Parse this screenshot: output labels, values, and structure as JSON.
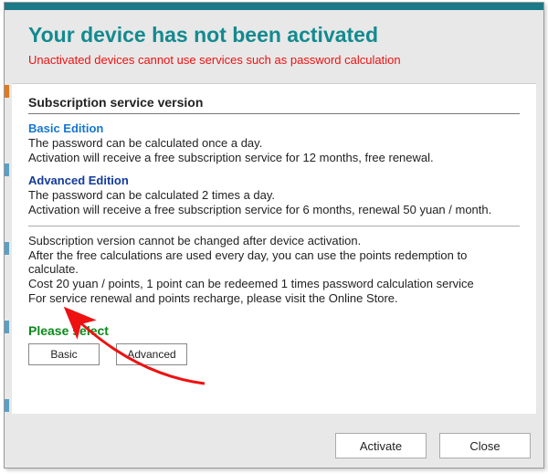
{
  "header": {
    "title": "Your device has not been activated",
    "warning": "Unactivated devices cannot use services such as password calculation"
  },
  "subscription": {
    "section_title": "Subscription service version",
    "basic": {
      "name": "Basic Edition",
      "line1": "The password can be calculated once a day.",
      "line2": "Activation will receive a free subscription service for 12 months, free renewal."
    },
    "advanced": {
      "name": "Advanced Edition",
      "line1": "The password can be calculated 2 times a day.",
      "line2": "Activation will receive a free subscription service for 6 months, renewal 50 yuan / month."
    },
    "notes": {
      "n1": "Subscription version cannot be changed after device activation.",
      "n2": "After the free calculations are used every day, you can use the points redemption to calculate.",
      "n3": "Cost 20 yuan / points, 1 point can be redeemed 1 times password calculation service",
      "n4": "For service renewal and points recharge, please visit the Online Store."
    }
  },
  "select": {
    "label": "Please select",
    "basic": "Basic",
    "advanced": "Advanced"
  },
  "buttons": {
    "activate": "Activate",
    "close": "Close"
  },
  "colors": {
    "teal": "#138a8f",
    "red": "#e11",
    "blue1": "#1676d0",
    "blue2": "#123a9a",
    "green": "#0a8a1a"
  }
}
